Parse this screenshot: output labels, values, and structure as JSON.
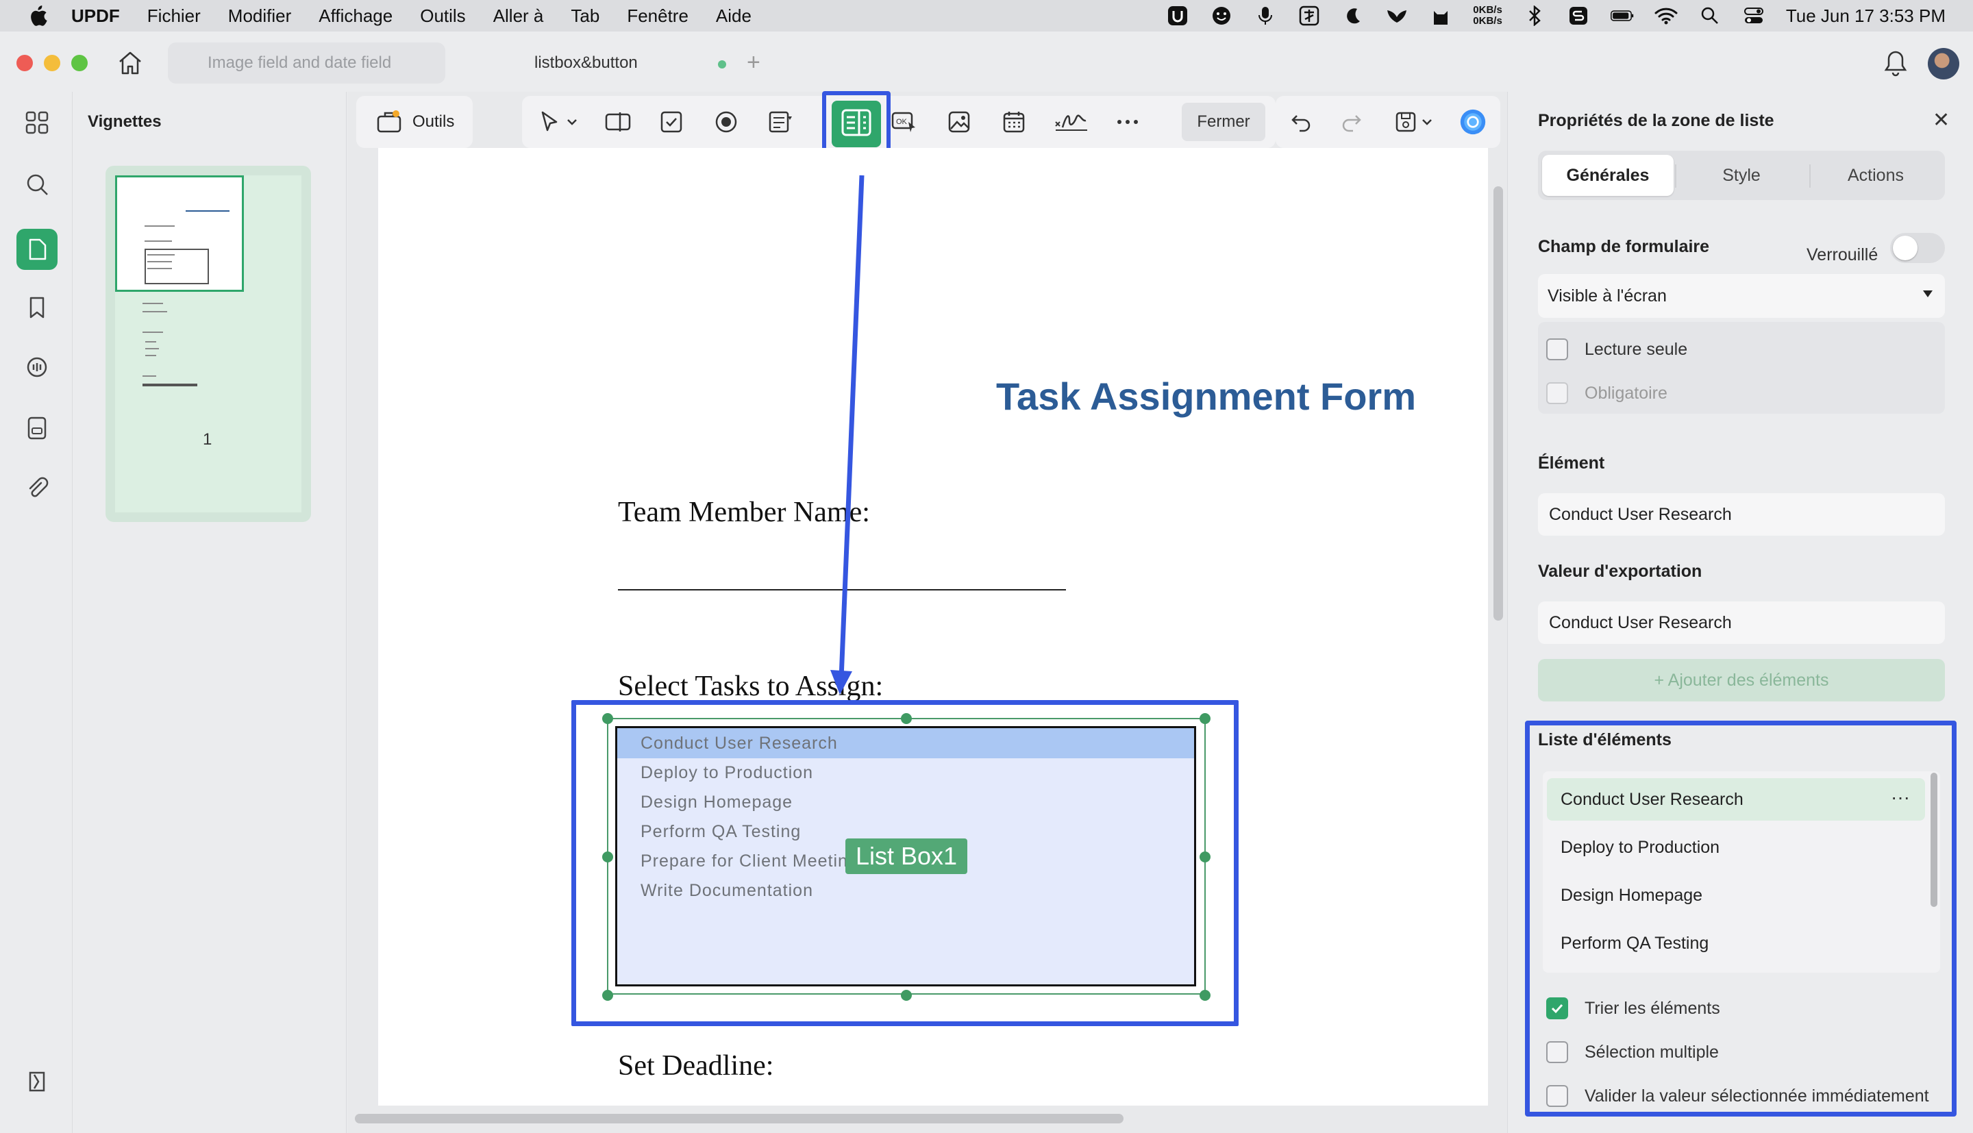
{
  "menubar": {
    "app_name": "UPDF",
    "items": [
      "Fichier",
      "Modifier",
      "Affichage",
      "Outils",
      "Aller à",
      "Tab",
      "Fenêtre",
      "Aide"
    ],
    "net_up": "0KB/s",
    "net_down": "0KB/s",
    "clock": "Tue Jun 17  3:53 PM"
  },
  "tabs": [
    {
      "label": "Image field and date field"
    },
    {
      "label": "listbox&button"
    }
  ],
  "thumbnails": {
    "heading": "Vignettes",
    "page_number": "1"
  },
  "toolbar": {
    "tools_label": "Outils",
    "close_label": "Fermer"
  },
  "document": {
    "title": "Task Assignment Form",
    "team_member_label": "Team Member Name:",
    "select_tasks_label": "Select Tasks to Assign:",
    "deadline_label": "Set Deadline:",
    "listbox_name": "List Box1",
    "listbox_items": [
      "Conduct User Research",
      "Deploy to Production",
      "Design Homepage",
      "Perform QA Testing",
      "Prepare for Client Meeting",
      "Write Documentation"
    ],
    "listbox_selected_index": 0
  },
  "panel": {
    "title": "Propriétés de la zone de liste",
    "tabs": [
      "Générales",
      "Style",
      "Actions"
    ],
    "active_tab": "Générales",
    "form_field_label": "Champ de formulaire",
    "locked_label": "Verrouillé",
    "locked": false,
    "visibility_value": "Visible à l'écran",
    "readonly_label": "Lecture seule",
    "required_label": "Obligatoire",
    "element_label": "Élément",
    "element_value": "Conduct User Research",
    "export_label": "Valeur d'exportation",
    "export_value": "Conduct User Research",
    "add_items_label": "+ Ajouter des éléments",
    "items_list_label": "Liste d'éléments",
    "items": [
      "Conduct User Research",
      "Deploy to Production",
      "Design Homepage",
      "Perform QA Testing"
    ],
    "sort_items_label": "Trier les éléments",
    "sort_items": true,
    "multi_select_label": "Sélection multiple",
    "multi_select": false,
    "commit_label": "Valider la valeur sélectionnée immédiatement",
    "commit_immediately": false
  },
  "colors": {
    "accent_green": "#2fa66b",
    "highlight_blue": "#3556e0",
    "title_blue": "#2c5c96"
  }
}
